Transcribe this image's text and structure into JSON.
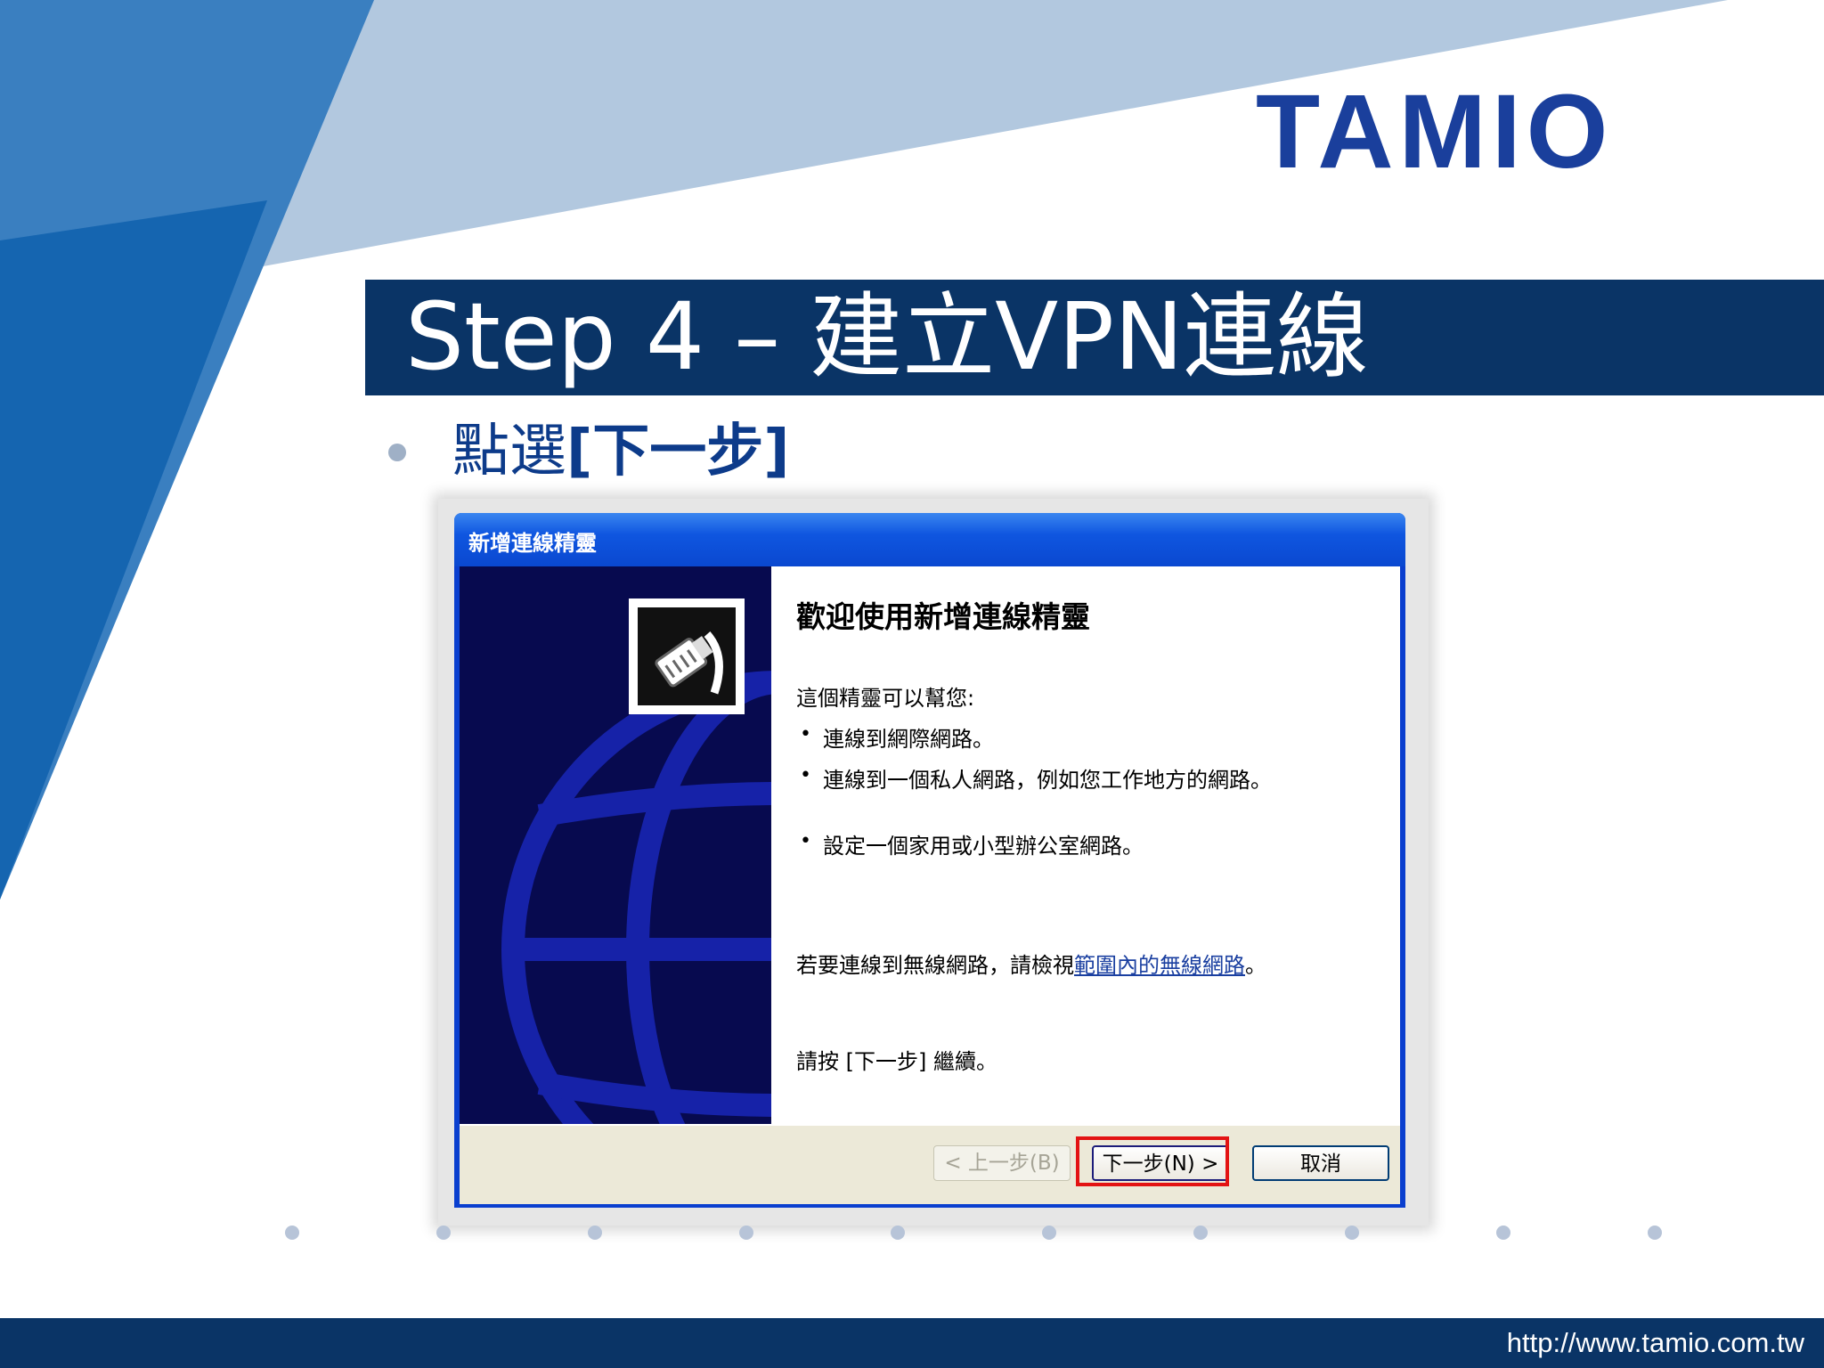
{
  "slide": {
    "logo_text": "TAMIO",
    "title": "Step 4 – 建立VPN連線",
    "bullet_prefix": "點選",
    "bullet_action": "[下一步]",
    "footer_url": "http://www.tamio.com.tw"
  },
  "dialog": {
    "title": "新增連線精靈",
    "heading": "歡迎使用新增連線精靈",
    "intro": "這個精靈可以幫您:",
    "bullets": [
      "連線到網際網路。",
      "連線到一個私人網路，例如您工作地方的網路。",
      "設定一個家用或小型辦公室網路。"
    ],
    "wireless_text": "若要連線到無線網路，請檢視",
    "wireless_link": "範圍內的無線網路",
    "wireless_end": "。",
    "continue_text": "請按 [下一步] 繼續。",
    "buttons": {
      "back": "< 上一步(B)",
      "next": "下一步(N) >",
      "cancel": "取消"
    }
  },
  "colors": {
    "title_bar": "#0a3466",
    "logo": "#1a3f9c",
    "highlight": "#e31313",
    "xp_title": "#0a48d0"
  }
}
